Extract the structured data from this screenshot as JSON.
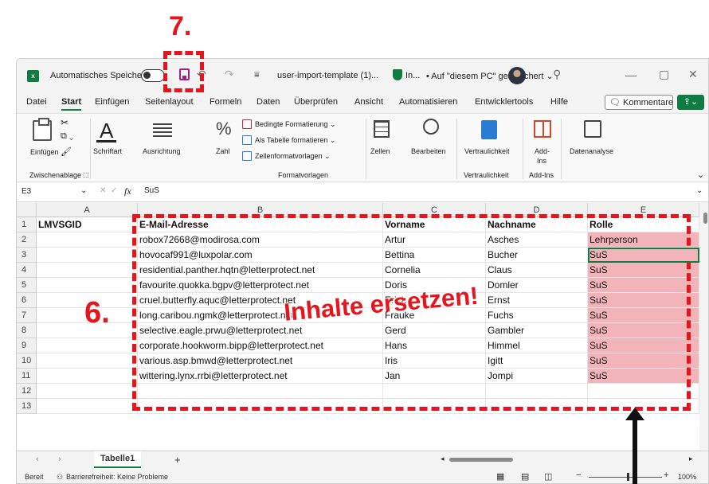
{
  "annotations": {
    "step7": "7.",
    "step6": "6.",
    "replace_text": "Inhalte ersetzen!"
  },
  "titlebar": {
    "autosave_label": "Automatisches Speichern",
    "filename": "user-import-template (1)...",
    "location_prefix": "In...",
    "location": "• Auf \"diesem PC\" gespeichert ⌄"
  },
  "menu": {
    "items": [
      "Datei",
      "Start",
      "Einfügen",
      "Seitenlayout",
      "Formeln",
      "Daten",
      "Überprüfen",
      "Ansicht",
      "Automatisieren",
      "Entwicklertools",
      "Hilfe"
    ],
    "active": "Start",
    "comments": "Kommentare"
  },
  "ribbon": {
    "paste": "Einfügen",
    "clipboard_group": "Zwischenablage",
    "font": "Schriftart",
    "alignment": "Ausrichtung",
    "number": "Zahl",
    "cond_format": "Bedingte Formatierung ⌄",
    "as_table": "Als Tabelle formatieren ⌄",
    "cell_styles": "Zellenformatvorlagen ⌄",
    "styles_group": "Formatvorlagen",
    "cells": "Zellen",
    "editing": "Bearbeiten",
    "sensitivity": "Vertraulichkeit",
    "sensitivity_group": "Vertraulichkeit",
    "addins_line1": "Add-",
    "addins_line2": "Ins",
    "addins_group": "Add-Ins",
    "data_analysis": "Datenanalyse"
  },
  "formula_bar": {
    "name_box": "E3",
    "fx": "fx",
    "value": "SuS"
  },
  "sheet": {
    "columns": [
      "A",
      "B",
      "C",
      "D",
      "E"
    ],
    "row_numbers": [
      "1",
      "2",
      "3",
      "4",
      "5",
      "6",
      "7",
      "8",
      "9",
      "10",
      "11",
      "12",
      "13"
    ],
    "header": [
      "LMVSGID",
      "E-Mail-Adresse",
      "Vorname",
      "Nachname",
      "Rolle"
    ],
    "rows": [
      [
        "",
        "robox72668@modirosa.com",
        "Artur",
        "Asches",
        "Lehrperson"
      ],
      [
        "",
        "hovocaf991@luxpolar.com",
        "Bettina",
        "Bucher",
        "SuS"
      ],
      [
        "",
        "residential.panther.hqtn@letterprotect.net",
        "Cornelia",
        "Claus",
        "SuS"
      ],
      [
        "",
        "favourite.quokka.bgpv@letterprotect.net",
        "Doris",
        "Domler",
        "SuS"
      ],
      [
        "",
        "cruel.butterfly.aquc@letterprotect.net",
        "Erich",
        "Ernst",
        "SuS"
      ],
      [
        "",
        "long.caribou.ngmk@letterprotect.net",
        "Frauke",
        "Fuchs",
        "SuS"
      ],
      [
        "",
        "selective.eagle.prwu@letterprotect.net",
        "Gerd",
        "Gambler",
        "SuS"
      ],
      [
        "",
        "corporate.hookworm.bipp@letterprotect.net",
        "Hans",
        "Himmel",
        "SuS"
      ],
      [
        "",
        "various.asp.bmwd@letterprotect.net",
        "Iris",
        "Igitt",
        "SuS"
      ],
      [
        "",
        "wittering.lynx.rrbi@letterprotect.net",
        "Jan",
        "Jompi",
        "SuS"
      ]
    ],
    "selected_cell": "E3"
  },
  "tabs": {
    "sheet_name": "Tabelle1",
    "add": "+"
  },
  "status": {
    "ready": "Bereit",
    "accessibility": "Barrierefreiheit: Keine Probleme",
    "zoom": "100%"
  },
  "colors": {
    "annotation_red": "#e8141c",
    "excel_green": "#107c41",
    "highlight_pink": "#f3b4b9"
  }
}
